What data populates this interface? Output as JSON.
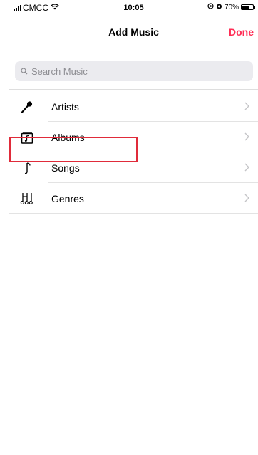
{
  "status_bar": {
    "carrier": "CMCC",
    "time": "10:05",
    "battery": "70%",
    "battery_level": 0.7
  },
  "nav": {
    "title": "Add Music",
    "done_label": "Done"
  },
  "search": {
    "placeholder": "Search Music"
  },
  "list": {
    "items": [
      {
        "label": "Artists",
        "icon": "microphone-icon"
      },
      {
        "label": "Albums",
        "icon": "album-icon"
      },
      {
        "label": "Songs",
        "icon": "music-note-icon"
      },
      {
        "label": "Genres",
        "icon": "genres-icon"
      }
    ],
    "highlighted": "Songs"
  },
  "colors": {
    "accent": "#ff2d55",
    "highlight_box": "#e02b3a"
  }
}
